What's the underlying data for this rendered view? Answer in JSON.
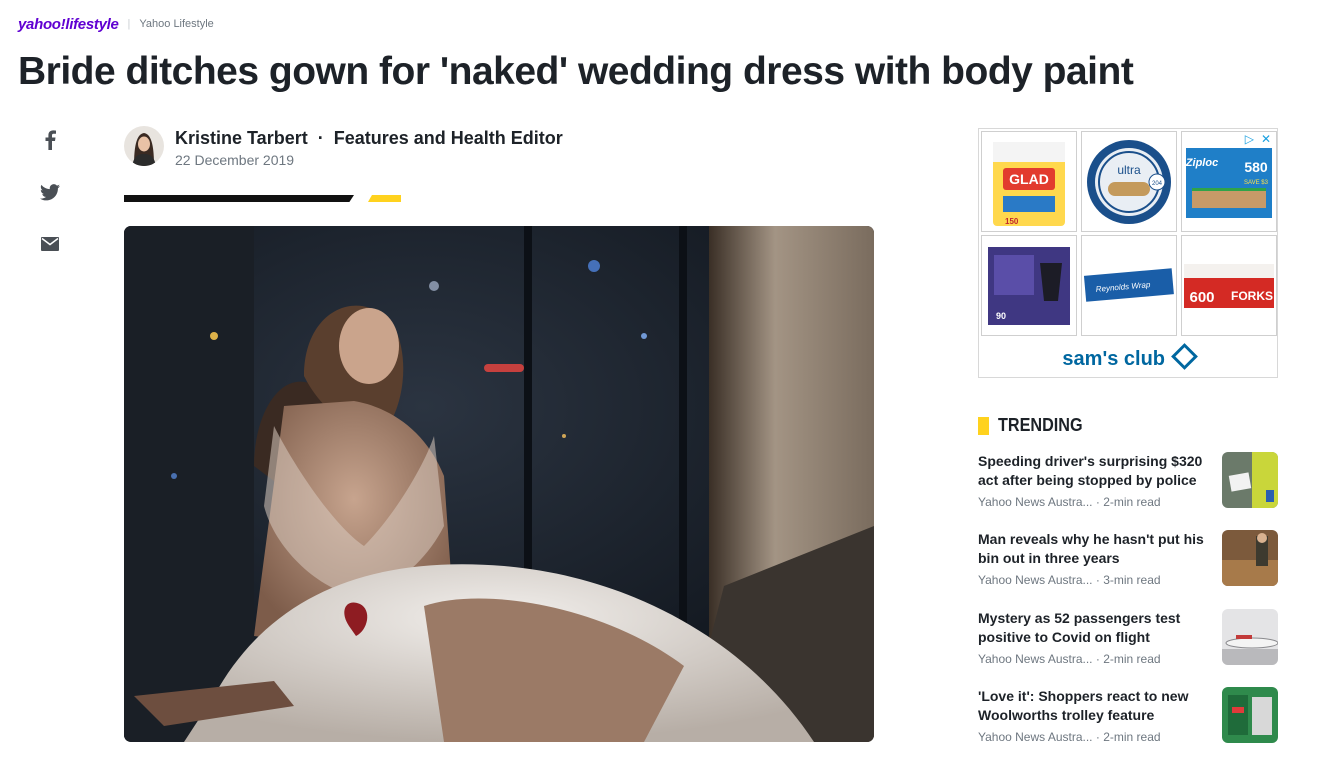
{
  "brand": {
    "logo": "yahoo!lifestyle",
    "section": "Yahoo Lifestyle"
  },
  "article": {
    "headline": "Bride ditches gown for 'naked' wedding dress with body paint",
    "author": "Kristine Tarbert",
    "role": "Features and Health Editor",
    "date": "22 December 2019"
  },
  "share": [
    {
      "name": "facebook",
      "icon": "facebook-icon"
    },
    {
      "name": "twitter",
      "icon": "twitter-icon"
    },
    {
      "name": "email",
      "icon": "mail-icon"
    }
  ],
  "ad": {
    "advertiser": "sam's club",
    "products": [
      "GLAD",
      "ultra",
      "Ziploc",
      "Party cups",
      "Reynolds Wrap",
      "FORKS"
    ],
    "product_texts": {
      "glad_count": "150",
      "ultra_count": "204",
      "ziploc_count": "580",
      "ziploc_tag": "SAVE $3",
      "cups_count": "90",
      "forks_count": "600"
    }
  },
  "trending": {
    "title": "TRENDING",
    "items": [
      {
        "headline": "Speeding driver's surprising $320 act after being stopped by police",
        "source": "Yahoo News Austra...",
        "read": "2-min read"
      },
      {
        "headline": "Man reveals why he hasn't put his bin out in three years",
        "source": "Yahoo News Austra...",
        "read": "3-min read"
      },
      {
        "headline": "Mystery as 52 passengers test positive to Covid on flight",
        "source": "Yahoo News Austra...",
        "read": "2-min read"
      },
      {
        "headline": "'Love it': Shoppers react to new Woolworths trolley feature",
        "source": "Yahoo News Austra...",
        "read": "2-min read"
      }
    ]
  },
  "colors": {
    "brand_purple": "#6001d2",
    "accent_yellow": "#ffd21e",
    "text": "#1d2228",
    "muted": "#6e7780"
  }
}
